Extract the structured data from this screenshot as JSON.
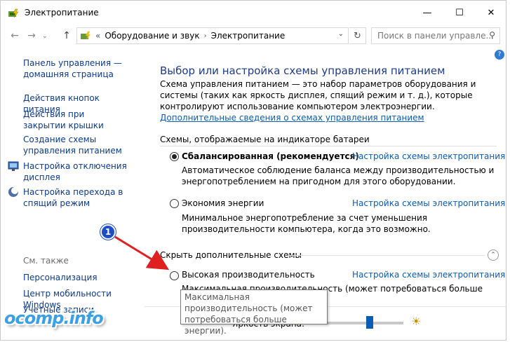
{
  "window": {
    "title": "Электропитание",
    "minimize_glyph": "—",
    "maximize_glyph": "☐",
    "close_glyph": "✕"
  },
  "nav": {
    "back_glyph": "←",
    "forward_glyph": "→",
    "history_glyph": "⌄",
    "up_glyph": "↑",
    "breadcrumb_root_glyph": "«",
    "breadcrumbs": [
      "Оборудование и звук",
      "Электропитание"
    ],
    "breadcrumb_sep": "›",
    "dropdown_glyph": "⌄",
    "refresh_glyph": "↻",
    "search_placeholder": "Поиск в панели управле...",
    "search_glyph": "⚲"
  },
  "sidebar": {
    "home": "Панель управления — домашняя страница",
    "links": [
      "Действия кнопок питания",
      "Действия при закрытии крышки",
      "Создание схемы управления питанием",
      "Настройка отключения дисплея",
      "Настройка перехода в спящий режим"
    ],
    "see_also_title": "См. также",
    "see_also": [
      "Персонализация",
      "Центр мобильности Windows",
      "Учетные записи"
    ]
  },
  "main": {
    "heading": "Выбор или настройка схемы управления питанием",
    "description": "Схема управления питанием — это набор параметров оборудования и системы (таких как яркость дисплея, спящий режим и т. д.), которые контролируют использование компьютером электроэнергии.",
    "description_link": "Дополнительные сведения о схемах управления питанием",
    "section_battery": "Схемы, отображаемые на индикаторе батареи",
    "section_hidden": "Скрыть дополнительные схемы",
    "collapse_glyph": "⌃",
    "plans": [
      {
        "name": "Сбалансированная (рекомендуется)",
        "selected": true,
        "link": "Настройка схемы электропитания",
        "desc": "Автоматическое соблюдение баланса между производительностью и энергопотреблением на пригодном для этого оборудовании."
      },
      {
        "name": "Экономия энергии",
        "selected": false,
        "link": "Настройка схемы электропитания",
        "desc": "Минимальное энергопотребление за счет уменьшения производительности компьютера, когда это возможно."
      },
      {
        "name": "Высокая производительность",
        "selected": false,
        "link": "Настройка схемы электропитания",
        "desc": "Максимальная производительность (может потребоваться больше энергии)."
      }
    ],
    "tooltip": "Максимальная производительность (может потребоваться больше энергии).",
    "brightness_label": "Яркость экрана:",
    "brightness_level": 0.65,
    "sun_glyph": "☀"
  },
  "annotation": {
    "badge": "1",
    "color": "#e02020"
  },
  "watermark": "ocomp.info"
}
